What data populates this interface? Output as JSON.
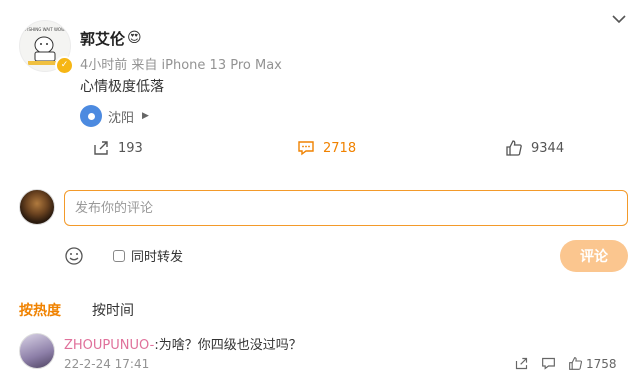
{
  "post": {
    "username": "郭艾伦",
    "user_emoji": "😍",
    "verified_badge": "✓",
    "avatar_caption": "FISHING WAIT WOW",
    "meta": "4小时前  来自 iPhone 13 Pro Max",
    "text": "心情极度低落",
    "location": "沈阳",
    "location_arrow": "▶",
    "actions": {
      "share_count": "193",
      "comment_count": "2718",
      "like_count": "9344"
    }
  },
  "composer": {
    "placeholder": "发布你的评论",
    "repost_label": "同时转发",
    "submit_label": "评论"
  },
  "sort_tabs": {
    "hot": "按热度",
    "time": "按时间"
  },
  "comments": [
    {
      "user": "ZHOUPUNUO-",
      "text": ":为啥？你四级也没过吗？",
      "time": "22-2-24 17:41",
      "like_count": "1758"
    }
  ],
  "colors": {
    "accent": "#f08200",
    "input_border": "#f39a2a",
    "submit_disabled": "#fbc68f",
    "comment_user": "#e0719b",
    "location_pin": "#4c8ae0",
    "verified_badge": "#f6b615"
  },
  "icons": {
    "share": "share-icon",
    "comment": "comment-icon",
    "like": "thumbs-up-icon",
    "emoji": "smiley-icon",
    "more": "chevron-down-icon"
  }
}
